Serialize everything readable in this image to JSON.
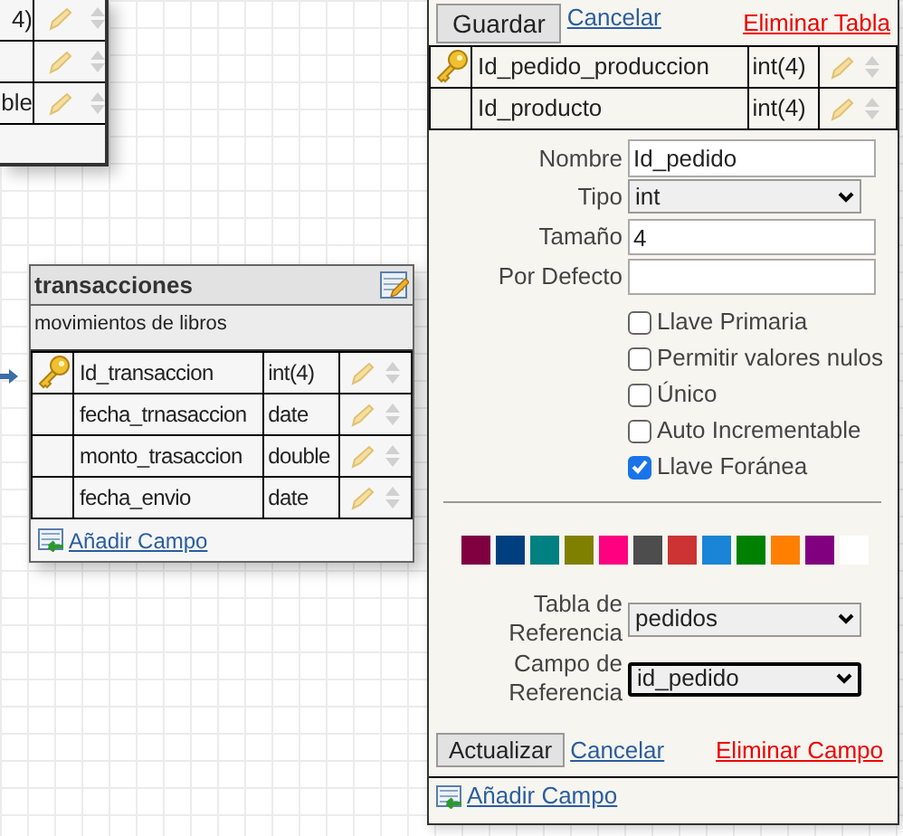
{
  "partial_table": {
    "rows": [
      {
        "type": "4)",
        "primary_key": false
      },
      {
        "primary_key": false
      },
      {
        "type": "ble",
        "primary_key": false
      }
    ]
  },
  "table": {
    "title": "transacciones",
    "description": "movimientos de libros",
    "fields": [
      {
        "name": "Id_transaccion",
        "type": "int(4)",
        "primary_key": true
      },
      {
        "name": "fecha_trnasaccion",
        "type": "date",
        "primary_key": false
      },
      {
        "name": "monto_trasaccion",
        "type": "double",
        "primary_key": false
      },
      {
        "name": "fecha_envio",
        "type": "date",
        "primary_key": false
      }
    ],
    "add_field": "Añadir Campo"
  },
  "editor": {
    "save": "Guardar",
    "cancel": "Cancelar",
    "delete_table": "Eliminar Tabla",
    "fields": [
      {
        "name": "Id_pedido_produccion",
        "type": "int(4)",
        "primary_key": true
      },
      {
        "name": "Id_producto",
        "type": "int(4)",
        "primary_key": false
      }
    ],
    "form": {
      "name": {
        "label": "Nombre",
        "value": "Id_pedido"
      },
      "type": {
        "label": "Tipo",
        "value": "int"
      },
      "size": {
        "label": "Tamaño",
        "value": "4"
      },
      "default": {
        "label": "Por Defecto"
      },
      "checkboxes": [
        {
          "label": "Llave Primaria",
          "checked": false
        },
        {
          "label": "Permitir valores nulos",
          "checked": false
        },
        {
          "label": "Único",
          "checked": false
        },
        {
          "label": "Auto Incrementable",
          "checked": false
        },
        {
          "label": "Llave Foránea",
          "checked": true
        }
      ],
      "colors": [
        {
          "color": "#7f0040"
        },
        {
          "color": "#003f7f"
        },
        {
          "color": "#008080"
        },
        {
          "color": "#808000"
        },
        {
          "color": "#ff0080"
        },
        {
          "color": "#4d4d4d"
        },
        {
          "color": "#cc3333"
        },
        {
          "color": "#1a85d6"
        },
        {
          "color": "#008000"
        },
        {
          "color": "#ff8000"
        },
        {
          "color": "#800080"
        },
        {
          "color": "#ffffff"
        }
      ],
      "ref_table": {
        "label": "Tabla de Referencia",
        "value": "pedidos",
        "focused": false
      },
      "ref_field": {
        "label": "Campo de Referencia",
        "value": "id_pedido",
        "focused": true
      }
    },
    "update": "Actualizar",
    "cancel_field": "Cancelar",
    "delete_field": "Eliminar Campo",
    "add_field": "Añadir Campo"
  }
}
